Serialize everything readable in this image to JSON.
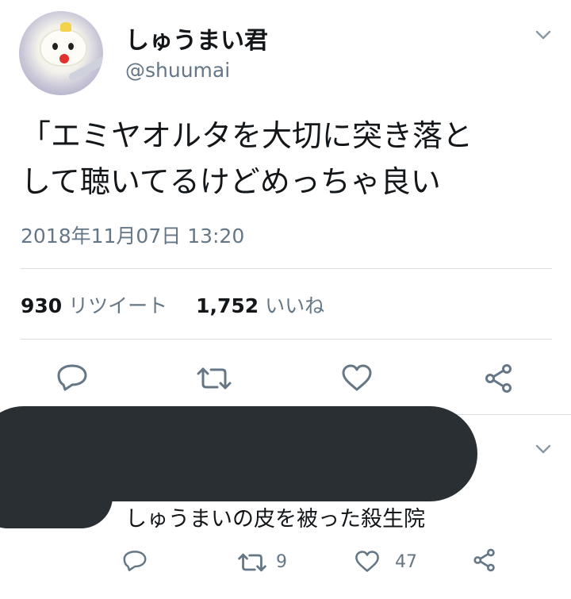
{
  "tweet": {
    "display_name": "しゅうまい君",
    "handle": "@shuumai",
    "text_line1": "「エミヤオルタを大切に突き落と",
    "text_line2": "して聴いてるけどめっちゃ良い",
    "timestamp": "2018年11月07日 13:20",
    "retweet_count": "930",
    "retweet_label": "リツイート",
    "like_count": "1,752",
    "like_label": "いいね"
  },
  "reply": {
    "text": "しゅうまいの皮を被った殺生院",
    "retweet_count": "9",
    "like_count": "47"
  },
  "icons": {
    "menu": "chevron-down-icon",
    "reply": "reply-icon",
    "retweet": "retweet-icon",
    "like": "heart-icon",
    "share": "share-icon"
  },
  "colors": {
    "text": "#14171a",
    "secondary": "#657786",
    "icon": "#657786",
    "divider": "#d7dde2",
    "redaction": "#2a2f33"
  }
}
